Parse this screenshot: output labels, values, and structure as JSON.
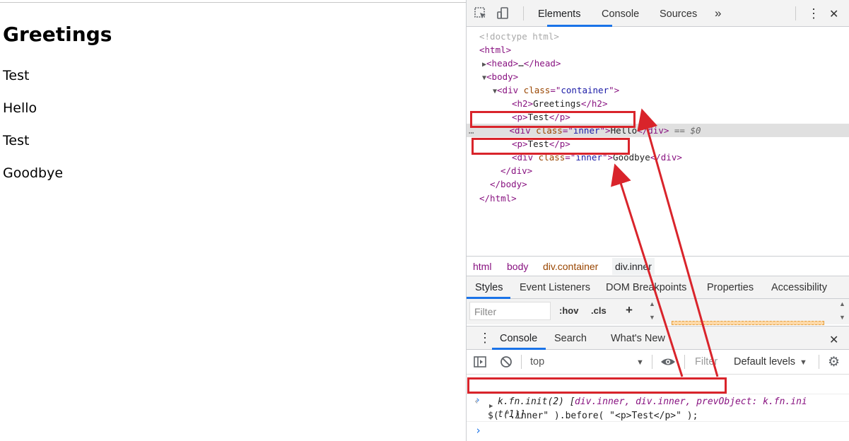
{
  "page": {
    "heading": "Greetings",
    "paras": [
      "Test",
      "Hello",
      "Test",
      "Goodbye"
    ]
  },
  "devtools": {
    "toolbar": {
      "tabs": [
        "Elements",
        "Console",
        "Sources"
      ],
      "more": "»",
      "menu": "⋮",
      "close": "✕"
    },
    "dom_lines": {
      "doctype": "<!doctype html>",
      "html_open": "<html>",
      "head": [
        "<head>",
        "…",
        "</head>"
      ],
      "body_open": "<body>",
      "div_open": {
        "tag": "<div ",
        "attr": "class",
        "eq": "=\"",
        "val": "container",
        "close": "\">"
      },
      "h2": {
        "open": "<h2>",
        "text": "Greetings",
        "close": "</h2>"
      },
      "p1": {
        "open": "<p>",
        "text": "Test",
        "close": "</p>"
      },
      "div_inner1": {
        "tag": "<div ",
        "attr": "class",
        "eq": "=\"",
        "val": "inner",
        "close": "\">",
        "text": "Hello",
        "end": "</div>",
        "marker": " == $0"
      },
      "p2": {
        "open": "<p>",
        "text": "Test",
        "close": "</p>"
      },
      "div_inner2": {
        "tag": "<div ",
        "attr": "class",
        "eq": "=\"",
        "val": "inner",
        "close": "\">",
        "text": "Goodbye",
        "end": "</div>"
      },
      "div_close": "</div>",
      "body_close": "</body>",
      "html_close": "</html>",
      "ellipsis": "…"
    },
    "breadcrumbs": [
      "html",
      "body",
      "div.container",
      "div.inner"
    ],
    "styles_tabs": [
      "Styles",
      "Event Listeners",
      "DOM Breakpoints",
      "Properties",
      "Accessibility"
    ],
    "filter_placeholder": "Filter",
    "hov": ":hov",
    "cls": ".cls",
    "plus": "+",
    "drawer_tabs": [
      "Console",
      "Search",
      "What's New"
    ],
    "console_toolbar": {
      "context": "top",
      "filter_placeholder": "Filter",
      "levels": "Default levels"
    },
    "console_input": "$( \".inner\" ).before( \"<p>Test</p>\" );",
    "console_output": {
      "prefix": "k.fn.init(2) [",
      "items": "div.inner, div.inner, prevObject: k.fn.ini",
      "wrap": "t(1)]"
    },
    "prompt_char": "›",
    "input_char": "›",
    "output_char": "‹"
  },
  "colors": {
    "annotation": "#d9242b",
    "accent": "#1a73e8",
    "tag": "#881280",
    "attr_name": "#994500",
    "attr_value": "#1a1aa6"
  }
}
